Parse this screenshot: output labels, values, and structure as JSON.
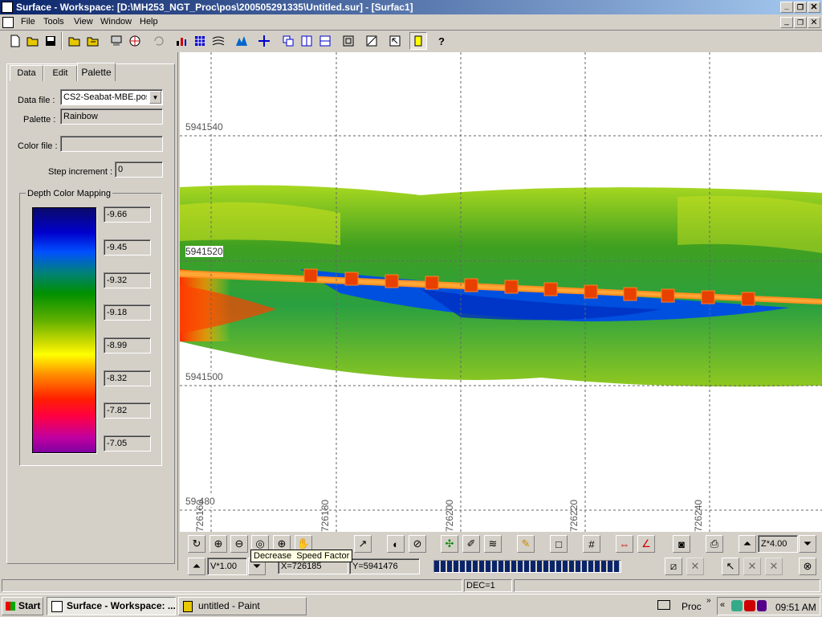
{
  "titlebar": {
    "title": "Surface - Workspace: [D:\\MH253_NGT_Proc\\pos\\200505291335\\Untitled.sur] - [Surfac1]"
  },
  "menu": {
    "items": [
      "File",
      "Tools",
      "View",
      "Window",
      "Help"
    ]
  },
  "panel": {
    "tabs": [
      "Data",
      "Edit",
      "Palette"
    ],
    "data_file_label": "Data file :",
    "data_file_value": "CS2-Seabat-MBE.pos",
    "palette_label": "Palette :",
    "palette_value": "Rainbow",
    "color_file_label": "Color file :",
    "color_file_value": "",
    "step_label": "Step increment :",
    "step_value": "0",
    "mapping_title": "Depth Color Mapping",
    "depths": [
      "-9.66",
      "-9.45",
      "-9.32",
      "-9.18",
      "-8.99",
      "-8.32",
      "-7.82",
      "-7.05"
    ]
  },
  "map": {
    "y_labels": [
      "5941540",
      "5941520",
      "5941500",
      "59 480"
    ],
    "x_labels": [
      "726160",
      "726180",
      "726200",
      "726220",
      "726240"
    ]
  },
  "bottom": {
    "tooltip": "Decrease  Speed Factor",
    "zoom_value": "Z*4.00",
    "v_value": "V*1.00",
    "x_coord": "X=726185",
    "y_coord": "Y=5941476",
    "dec": "DEC=1"
  },
  "taskbar": {
    "start": "Start",
    "task1": "Surface - Workspace: ...",
    "task2": "untitled - Paint",
    "proc": "Proc",
    "time": "09:51 AM"
  }
}
